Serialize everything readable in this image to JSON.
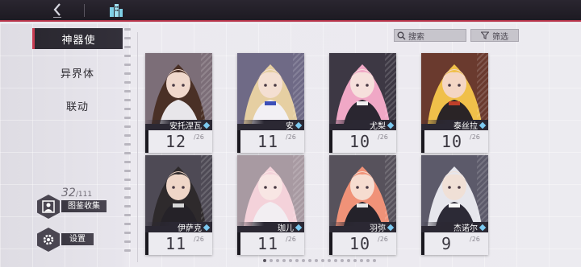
{
  "topbar": {
    "back_icon": "chevron-left-icon",
    "home_icon": "city-buildings-icon"
  },
  "nav": {
    "items": [
      {
        "label": "神器使",
        "active": true
      },
      {
        "label": "异界体",
        "active": false
      },
      {
        "label": "联动",
        "active": false
      }
    ]
  },
  "collection": {
    "current": "32",
    "total": "/111",
    "label": "图鉴收集"
  },
  "settings": {
    "label": "设置"
  },
  "search": {
    "label": "搜索"
  },
  "filter": {
    "label": "筛选"
  },
  "characters": [
    {
      "name": "安托涅瓦",
      "count": "12",
      "max": "/26"
    },
    {
      "name": "安",
      "count": "11",
      "max": "/26"
    },
    {
      "name": "尤梨",
      "count": "10",
      "max": "/26"
    },
    {
      "name": "泰丝拉",
      "count": "10",
      "max": "/26"
    },
    {
      "name": "伊萨克",
      "count": "11",
      "max": "/26"
    },
    {
      "name": "珈儿",
      "count": "11",
      "max": "/26"
    },
    {
      "name": "羽弥",
      "count": "10",
      "max": "/26"
    },
    {
      "name": "杰诺尔",
      "count": "9",
      "max": "/26"
    }
  ],
  "colors": {
    "accent": "#c83c52",
    "panel": "#2b2833",
    "badge": "#7cc9f0"
  },
  "pagination": {
    "total": 18,
    "active": 0
  }
}
